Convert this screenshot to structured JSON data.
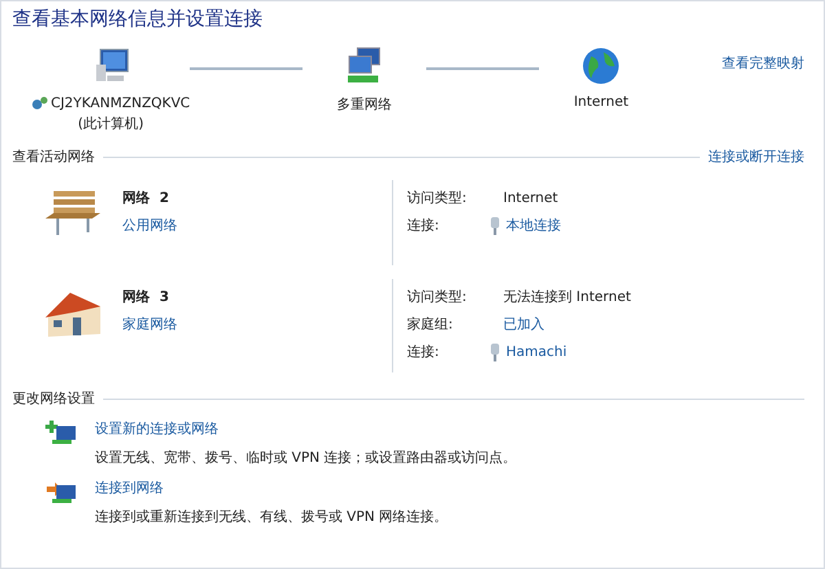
{
  "title": "查看基本网络信息并设置连接",
  "map": {
    "full_map_link": "查看完整映射",
    "nodes": [
      {
        "kind": "computer",
        "label": "CJ2YKANMZNZQKVC",
        "sublabel": "(此计算机)"
      },
      {
        "kind": "network",
        "label": "多重网络"
      },
      {
        "kind": "globe",
        "label": "Internet"
      }
    ]
  },
  "active": {
    "heading": "查看活动网络",
    "link": "连接或断开连接",
    "networks": [
      {
        "kind": "bench",
        "name": "网络  2",
        "type_link": "公用网络",
        "details": [
          {
            "label": "访问类型:",
            "kind": "text",
            "value": "Internet"
          },
          {
            "label": "连接:",
            "kind": "connection",
            "value": "本地连接"
          }
        ]
      },
      {
        "kind": "house",
        "name": "网络  3",
        "type_link": "家庭网络",
        "details": [
          {
            "label": "访问类型:",
            "kind": "text",
            "value": "无法连接到 Internet"
          },
          {
            "label": "家庭组:",
            "kind": "link",
            "value": "已加入"
          },
          {
            "label": "连接:",
            "kind": "connection",
            "value": "Hamachi"
          }
        ]
      }
    ]
  },
  "change": {
    "heading": "更改网络设置",
    "tasks": [
      {
        "kind": "new",
        "link": "设置新的连接或网络",
        "description": "设置无线、宽带、拨号、临时或 VPN 连接；或设置路由器或访问点。"
      },
      {
        "kind": "connect",
        "link": "连接到网络",
        "description": "连接到或重新连接到无线、有线、拨号或 VPN 网络连接。"
      }
    ]
  }
}
